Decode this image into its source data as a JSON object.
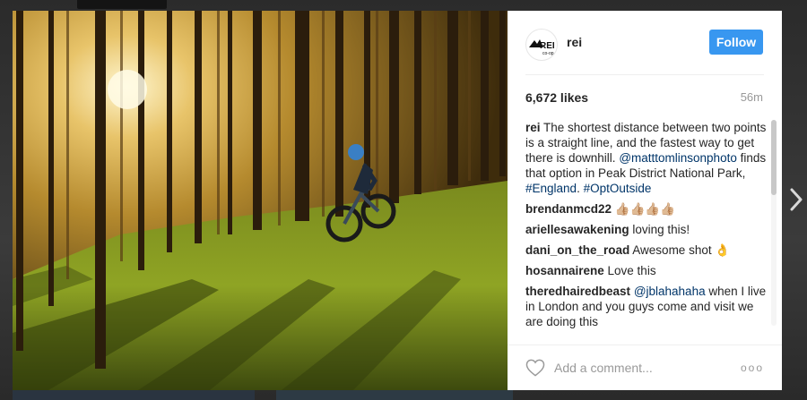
{
  "post": {
    "username": "rei",
    "follow_label": "Follow",
    "likes": "6,672 likes",
    "time_ago": "56m",
    "caption": {
      "user": "rei",
      "text_1": " The shortest distance between two points is a straight line, and the fastest way to get there is downhill. ",
      "mention": "@matttomlinsonphoto",
      "text_2": " finds that option in Peak District National Park, ",
      "hashtag_1": "#England",
      "text_3": ". ",
      "hashtag_2": "#OptOutside"
    },
    "comments": [
      {
        "user": "brendanmcd22",
        "text": " 👍🏼👍🏼👍🏼👍🏼"
      },
      {
        "user": "ariellesawakening",
        "text": " loving this!"
      },
      {
        "user": "dani_on_the_road",
        "text": " Awesome shot 👌"
      },
      {
        "user": "hosannairene",
        "text": " Love this"
      },
      {
        "user": "theredhairedbeast",
        "mention": "@jblahahaha",
        "text": " when I live in London and you guys come and visit we are doing this"
      }
    ],
    "comment_placeholder": "Add a comment...",
    "more_label": "ooo",
    "avatar_text": "REI",
    "avatar_subtext": "co-op"
  },
  "icons": {
    "heart": "heart-outline-icon",
    "next": "chevron-right-icon",
    "more": "more-options-icon"
  },
  "colors": {
    "follow_button": "#3897f0",
    "link": "#003569",
    "text": "#262626",
    "muted": "#999999"
  }
}
